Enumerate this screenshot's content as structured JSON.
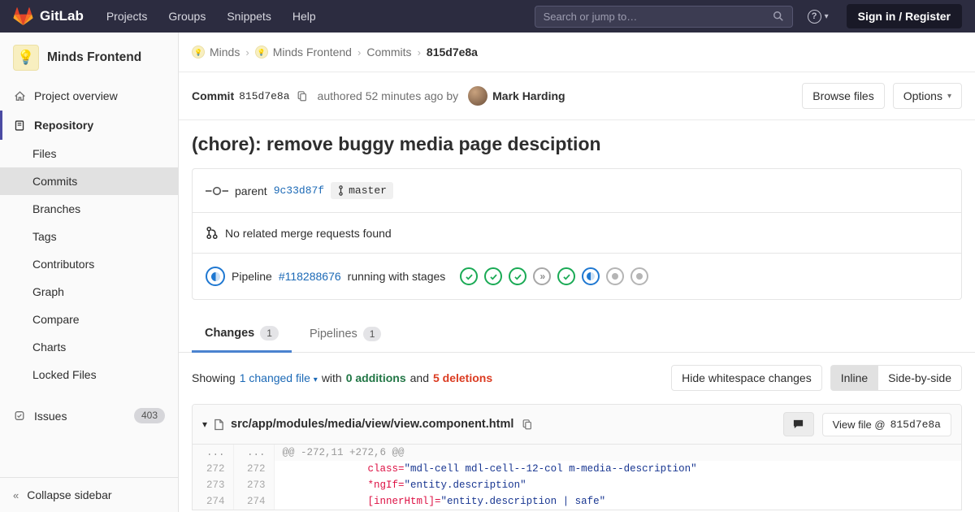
{
  "navbar": {
    "brand": "GitLab",
    "items": [
      "Projects",
      "Groups",
      "Snippets",
      "Help"
    ],
    "search_placeholder": "Search or jump to…",
    "signin": "Sign in / Register"
  },
  "sidebar": {
    "project": "Minds Frontend",
    "avatar": "💡",
    "overview": "Project overview",
    "repository": "Repository",
    "repo_items": [
      "Files",
      "Commits",
      "Branches",
      "Tags",
      "Contributors",
      "Graph",
      "Compare",
      "Charts",
      "Locked Files"
    ],
    "issues": "Issues",
    "issues_count": "403",
    "collapse": "Collapse sidebar"
  },
  "breadcrumb": {
    "minds": "Minds",
    "minds_frontend": "Minds Frontend",
    "commits": "Commits",
    "sha": "815d7e8a",
    "avatar": "💡"
  },
  "commit": {
    "label": "Commit",
    "sha": "815d7e8a",
    "authored": "authored 52 minutes ago by",
    "author": "Mark Harding",
    "browse": "Browse files",
    "options": "Options",
    "title": "(chore): remove buggy media page desciption"
  },
  "info": {
    "parent_label": "parent",
    "parent_sha": "9c33d87f",
    "branch": "master",
    "mr_text": "No related merge requests found",
    "pipeline_label": "Pipeline",
    "pipeline_id": "#118288676",
    "pipeline_status": "running with stages",
    "stages": [
      "success",
      "success",
      "success",
      "skipped",
      "success",
      "running",
      "created",
      "created"
    ]
  },
  "tabs": {
    "changes": "Changes",
    "changes_count": "1",
    "pipelines": "Pipelines",
    "pipelines_count": "1"
  },
  "toolbar": {
    "showing": "Showing",
    "changed_files": "1 changed file",
    "with_word": "with",
    "additions": "0 additions",
    "and_word": "and",
    "deletions": "5 deletions",
    "hide_ws": "Hide whitespace changes",
    "inline": "Inline",
    "side_by_side": "Side-by-side"
  },
  "file": {
    "path": "src/app/modules/media/view/view.component.html",
    "view_file": "View file @",
    "view_sha": "815d7e8a"
  },
  "diff": {
    "hunk_old": "...",
    "hunk_new": "...",
    "hunk": "@@ -272,11 +272,6 @@",
    "rows": [
      {
        "old": "272",
        "new": "272",
        "indent": "              ",
        "attr": "class=",
        "str": "\"mdl-cell mdl-cell--12-col m-media--description\""
      },
      {
        "old": "273",
        "new": "273",
        "indent": "              ",
        "attr": "*ngIf=",
        "str": "\"entity.description\""
      },
      {
        "old": "274",
        "new": "274",
        "indent": "              ",
        "attr": "[innerHtml]=",
        "str": "\"entity.description | safe\""
      }
    ]
  },
  "colors": {
    "brand_orange": "#fc6d26",
    "addition_green": "#217645",
    "deletion_red": "#db3b21",
    "link_blue": "#1b69b6",
    "running_blue": "#1f78d1",
    "navbar_bg": "#2c2c40"
  }
}
